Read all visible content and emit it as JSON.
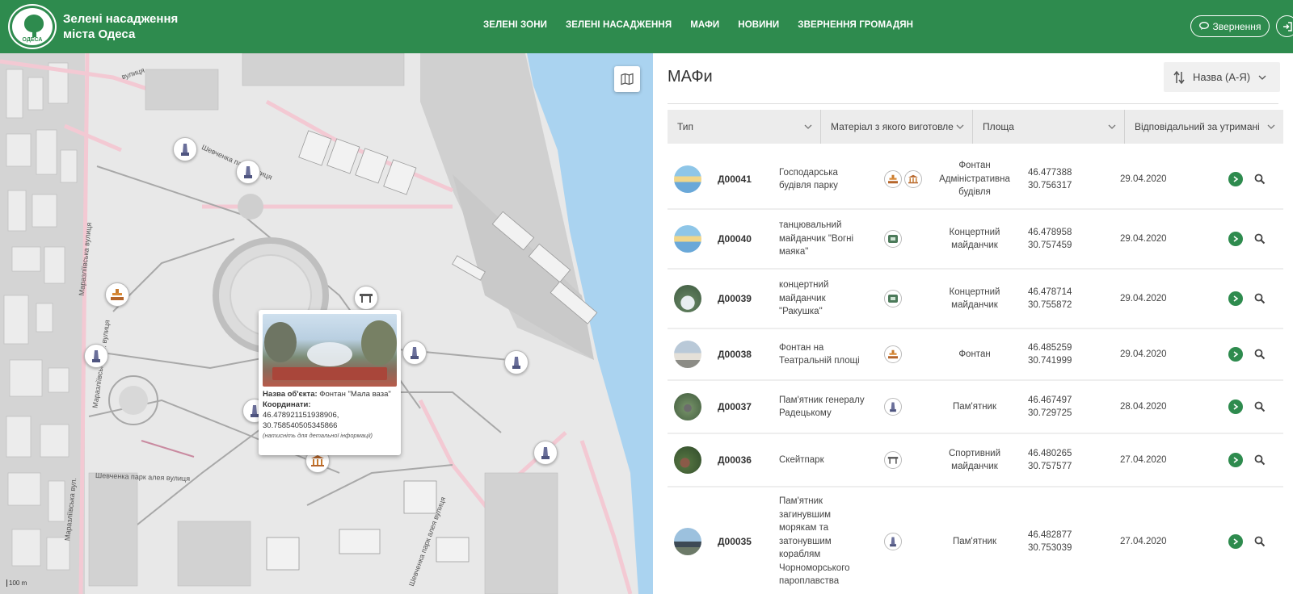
{
  "header": {
    "logo_text": "ОДЕСА",
    "title_line1": "Зелені насадження",
    "title_line2": "міста Одеса",
    "nav": [
      "ЗЕЛЕНІ ЗОНИ",
      "ЗЕЛЕНІ НАСАДЖЕННЯ",
      "МАФИ",
      "НОВИНИ",
      "ЗВЕРНЕННЯ ГРОМАДЯН"
    ],
    "appeal_label": "Звернення",
    "brand_color": "#2e8b4e"
  },
  "map": {
    "streets": [
      "вулиця",
      "Маразліївська вулиця",
      "Шевченка парк алея вулиця",
      "Маразліївська вул.",
      "Шевченка парк вулиця",
      "Маразліївська вул. вулиця",
      "Шевченка парк алея вулиця"
    ],
    "popup": {
      "name_label": "Назва об'єкта:",
      "name_value": "Фонтан \"Мала ваза\"",
      "coords_label": "Координати:",
      "coords_line1": "46.478921151938906,",
      "coords_line2": "30.758540505345866",
      "hint": "(натисніть для детальної інформації)"
    },
    "scale_label": "100 m",
    "marker_icons": [
      "monument-icon",
      "fountain-icon",
      "museum-icon",
      "sports-icon"
    ]
  },
  "panel": {
    "title": "МАФи",
    "sort_label": "Назва (А-Я)",
    "filters": [
      "Тип",
      "Матеріал з якого виготовле",
      "Площа",
      "Відповідальний за утримані"
    ],
    "rows": [
      {
        "code": "Д00041",
        "name": "Господарська будівля парку",
        "type": "Фонтан Адміністративна будівля",
        "lat": "46.477388",
        "lon": "30.756317",
        "date": "29.04.2020",
        "icons": [
          "fountain-icon",
          "museum-icon"
        ],
        "thumb": "pavilion"
      },
      {
        "code": "Д00040",
        "name": "танцювальний майданчик \"Вогні маяка\"",
        "type": "Концертний майданчик",
        "lat": "46.478958",
        "lon": "30.757459",
        "date": "29.04.2020",
        "icons": [
          "stage-icon"
        ],
        "thumb": "pavilion"
      },
      {
        "code": "Д00039",
        "name": "концертний майданчик \"Ракушка\"",
        "type": "Концертний майданчик",
        "lat": "46.478714",
        "lon": "30.755872",
        "date": "29.04.2020",
        "icons": [
          "stage-icon"
        ],
        "thumb": "photo-shell"
      },
      {
        "code": "Д00038",
        "name": "Фонтан на Театральній площі",
        "type": "Фонтан",
        "lat": "46.485259",
        "lon": "30.741999",
        "date": "29.04.2020",
        "icons": [
          "fountain-icon"
        ],
        "thumb": "photo-square"
      },
      {
        "code": "Д00037",
        "name": "Пам'ятник генералу Радецькому",
        "type": "Пам'ятник",
        "lat": "46.467497",
        "lon": "30.729725",
        "date": "28.04.2020",
        "icons": [
          "monument-icon"
        ],
        "thumb": "photo-monument"
      },
      {
        "code": "Д00036",
        "name": "Скейтпарк",
        "type": "Спортивний майданчик",
        "lat": "46.480265",
        "lon": "30.757577",
        "date": "27.04.2020",
        "icons": [
          "sports-icon"
        ],
        "thumb": "photo-park"
      },
      {
        "code": "Д00035",
        "name": "Пам'ятник загинувшим морякам та затонувшим кораблям Чорноморського пароплавства",
        "type": "Пам'ятник",
        "lat": "46.482877",
        "lon": "30.753039",
        "date": "27.04.2020",
        "icons": [
          "monument-icon"
        ],
        "thumb": "photo-sea"
      }
    ]
  }
}
